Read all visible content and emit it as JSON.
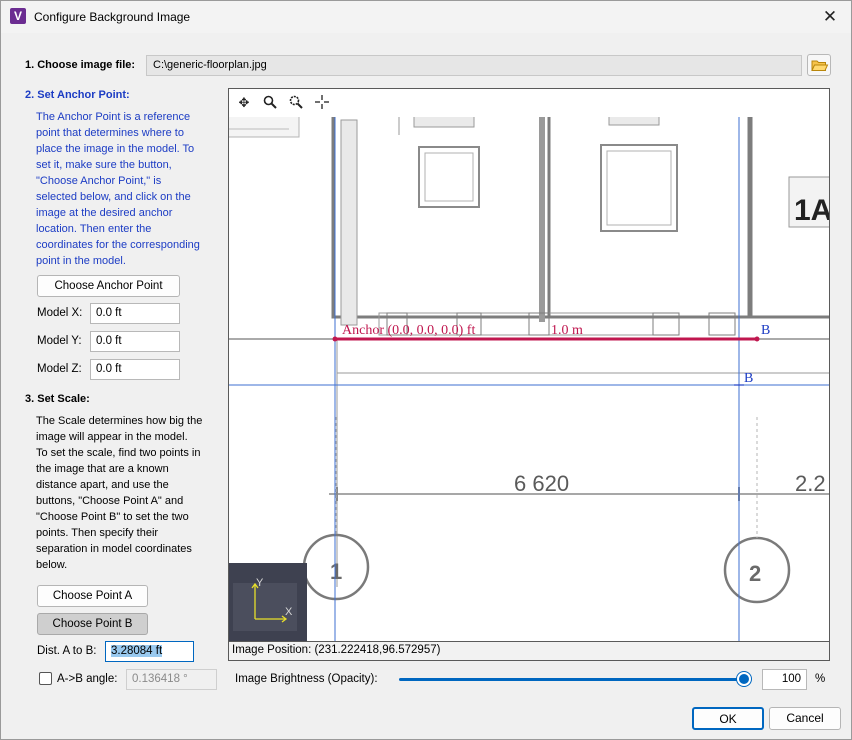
{
  "window": {
    "title": "Configure Background Image",
    "app_icon": "V"
  },
  "step1": {
    "label": "1. Choose image file:",
    "file_path": "C:\\generic-floorplan.jpg"
  },
  "step2": {
    "heading": "2. Set Anchor Point:",
    "lines": [
      "The Anchor Point is a reference",
      "point that determines where to",
      "place the image in the model.  To",
      "set it, make sure the button,",
      "\"Choose Anchor Point,\" is",
      "selected below, and click on the",
      "image at the desired anchor",
      "location.  Then enter the",
      "coordinates for the corresponding",
      "point in the model."
    ],
    "button": "Choose Anchor Point",
    "model_x_label": "Model X:",
    "model_x": "0.0 ft",
    "model_y_label": "Model Y:",
    "model_y": "0.0 ft",
    "model_z_label": "Model Z:",
    "model_z": "0.0 ft"
  },
  "step3": {
    "heading": "3. Set Scale:",
    "lines": [
      "The Scale determines how big the",
      "image will appear in the model.",
      "To set the scale, find two points in",
      "the image that are a known",
      "distance apart, and use the",
      "buttons, \"Choose Point A\" and",
      "\"Choose Point B\" to set the two",
      "points.  Then specify their",
      "separation in model coordinates",
      "below."
    ],
    "point_a_button": "Choose Point A",
    "point_b_button": "Choose Point B",
    "dist_label": "Dist. A to B:",
    "dist_value": "3.28084 ft",
    "angle_label": "A->B angle:",
    "angle_value": "0.136418 °",
    "angle_checked": false
  },
  "viewer": {
    "tools": [
      "pan-icon",
      "zoom-icon",
      "zoom-window-icon",
      "center-icon"
    ],
    "anchor_annotation": "Anchor (0.0, 0.0, 0.0) ft",
    "distance_annotation": "1.0 m",
    "point_b_marker": "B",
    "point_b_cursor": "B",
    "dimension_left": "6 620",
    "dimension_right": "2.2",
    "room_tag": "1A",
    "grid_label_1": "1",
    "grid_label_2": "2",
    "axis_y": "Y",
    "axis_x": "X",
    "status_label": "Image Position:",
    "status_value": "(231.222418,96.572957)"
  },
  "brightness": {
    "label": "Image Brightness (Opacity):",
    "value": "100",
    "unit": "%",
    "level_percent": 100
  },
  "footer": {
    "ok": "OK",
    "cancel": "Cancel"
  },
  "colors": {
    "accent": "#0067c0",
    "instructions": "#1c3cc4",
    "annotation": "#c0174f",
    "guide": "#3d6fd1"
  }
}
